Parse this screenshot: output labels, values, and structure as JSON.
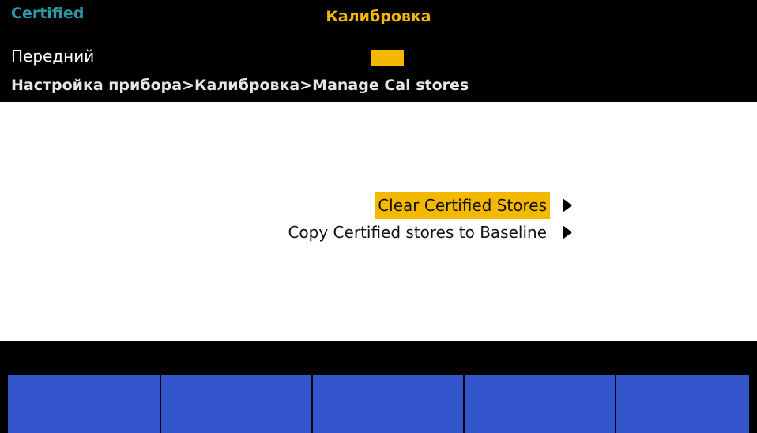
{
  "status": {
    "label": "Certified",
    "color": "#2b9aa6"
  },
  "title": "Калибровка",
  "header": {
    "mode": "Передний",
    "indicator_color": "#f5b800",
    "breadcrumb": "Настройка прибора>Калибровка>Manage Cal stores"
  },
  "menu": {
    "items": [
      {
        "label": "Clear Certified Stores",
        "selected": true,
        "icon": "triangle-right-icon"
      },
      {
        "label": "Copy Certified stores to Baseline",
        "selected": false,
        "icon": "triangle-right-icon"
      }
    ]
  },
  "softkeys": [
    {
      "label": ""
    },
    {
      "label": ""
    },
    {
      "label": ""
    },
    {
      "label": ""
    },
    {
      "label": ""
    }
  ],
  "colors": {
    "accent": "#f5b800",
    "softkey": "#3355cc",
    "background": "#000000"
  }
}
